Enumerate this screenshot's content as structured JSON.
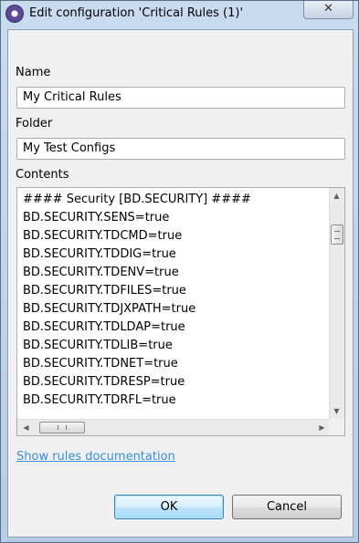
{
  "window": {
    "title": "Edit configuration 'Critical Rules (1)'",
    "close_label": "✕"
  },
  "fields": {
    "name_label": "Name",
    "name_value": "My Critical Rules",
    "folder_label": "Folder",
    "folder_value": "My Test Configs",
    "contents_label": "Contents"
  },
  "contents_lines": [
    "#### Security [BD.SECURITY] ####",
    "BD.SECURITY.SENS=true",
    "BD.SECURITY.TDCMD=true",
    "BD.SECURITY.TDDIG=true",
    "BD.SECURITY.TDENV=true",
    "BD.SECURITY.TDFILES=true",
    "BD.SECURITY.TDJXPATH=true",
    "BD.SECURITY.TDLDAP=true",
    "BD.SECURITY.TDLIB=true",
    "BD.SECURITY.TDNET=true",
    "BD.SECURITY.TDRESP=true",
    "BD.SECURITY.TDRFL=true"
  ],
  "link": {
    "label": "Show rules documentation"
  },
  "buttons": {
    "ok_label": "OK",
    "cancel_label": "Cancel"
  },
  "icons": {
    "app": "configuration-app-icon",
    "close": "close-icon"
  }
}
